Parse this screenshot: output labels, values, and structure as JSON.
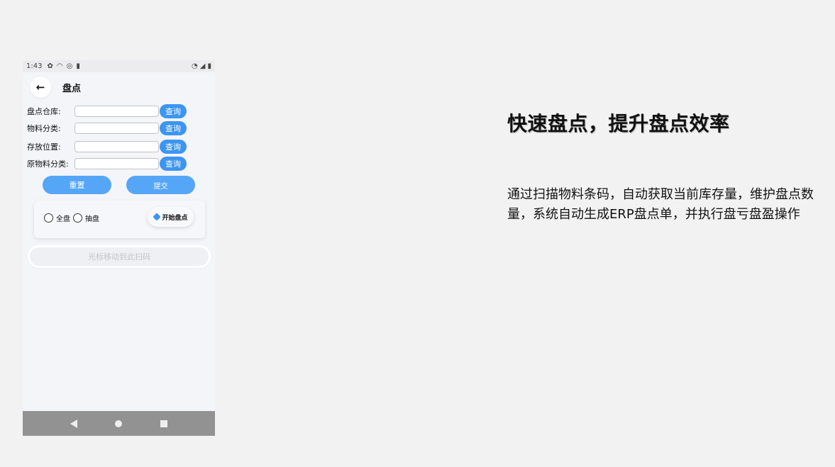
{
  "status_bar": {
    "time": "1:43",
    "icons_left": [
      "gear-icon",
      "wifi-icon",
      "at-icon",
      "sdcard-icon"
    ],
    "icons_right": [
      "wifi-signal-icon",
      "cell-signal-icon",
      "battery-icon"
    ]
  },
  "app_bar": {
    "title": "盘点"
  },
  "form": {
    "rows": [
      {
        "label": "盘点仓库:",
        "value": "",
        "button": "查询"
      },
      {
        "label": "物料分类:",
        "value": "",
        "button": "查询"
      },
      {
        "label": "存放位置:",
        "value": "",
        "button": "查询"
      },
      {
        "label": "原物料分类:",
        "value": "",
        "button": "查询"
      }
    ],
    "reset_label": "重置",
    "submit_label": "提交"
  },
  "mode": {
    "option_full": "全盘",
    "option_sample": "抽盘",
    "start_label": "开始盘点"
  },
  "scan": {
    "placeholder": "光标移动到此扫码"
  },
  "promo": {
    "headline": "快速盘点，提升盘点效率",
    "description": "通过扫描物料条码，自动获取当前库存量，维护盘点数量，系统自动生成ERP盘点单，并执行盘亏盘盈操作"
  }
}
